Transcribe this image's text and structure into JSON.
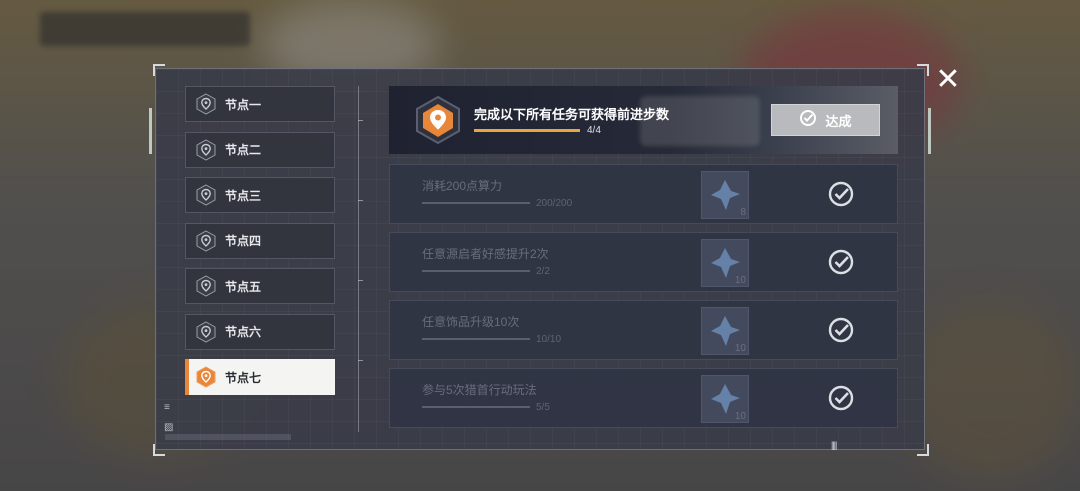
{
  "nodes": [
    {
      "label": "节点一",
      "active": false
    },
    {
      "label": "节点二",
      "active": false
    },
    {
      "label": "节点三",
      "active": false
    },
    {
      "label": "节点四",
      "active": false
    },
    {
      "label": "节点五",
      "active": false
    },
    {
      "label": "节点六",
      "active": false
    },
    {
      "label": "节点七",
      "active": true
    }
  ],
  "header": {
    "title": "完成以下所有任务可获得前进步数",
    "progress": "4/4",
    "progress_fraction": 1.0,
    "button_label": "达成"
  },
  "tasks": [
    {
      "title": "消耗200点算力",
      "progress": "200/200",
      "reward_qty": "8"
    },
    {
      "title": "任意源启者好感提升2次",
      "progress": "2/2",
      "reward_qty": "10"
    },
    {
      "title": "任意饰品升级10次",
      "progress": "10/10",
      "reward_qty": "10"
    },
    {
      "title": "参与5次猎首行动玩法",
      "progress": "5/5",
      "reward_qty": "10"
    }
  ],
  "icons": {
    "close": "close-icon",
    "node": "map-pin-icon",
    "check": "checkmark-circle-icon",
    "reward": "crystal-item-icon"
  },
  "colors": {
    "accent_orange": "#e8863a",
    "progress_gold": "#e8a640",
    "button_grey": "#b9babd"
  }
}
